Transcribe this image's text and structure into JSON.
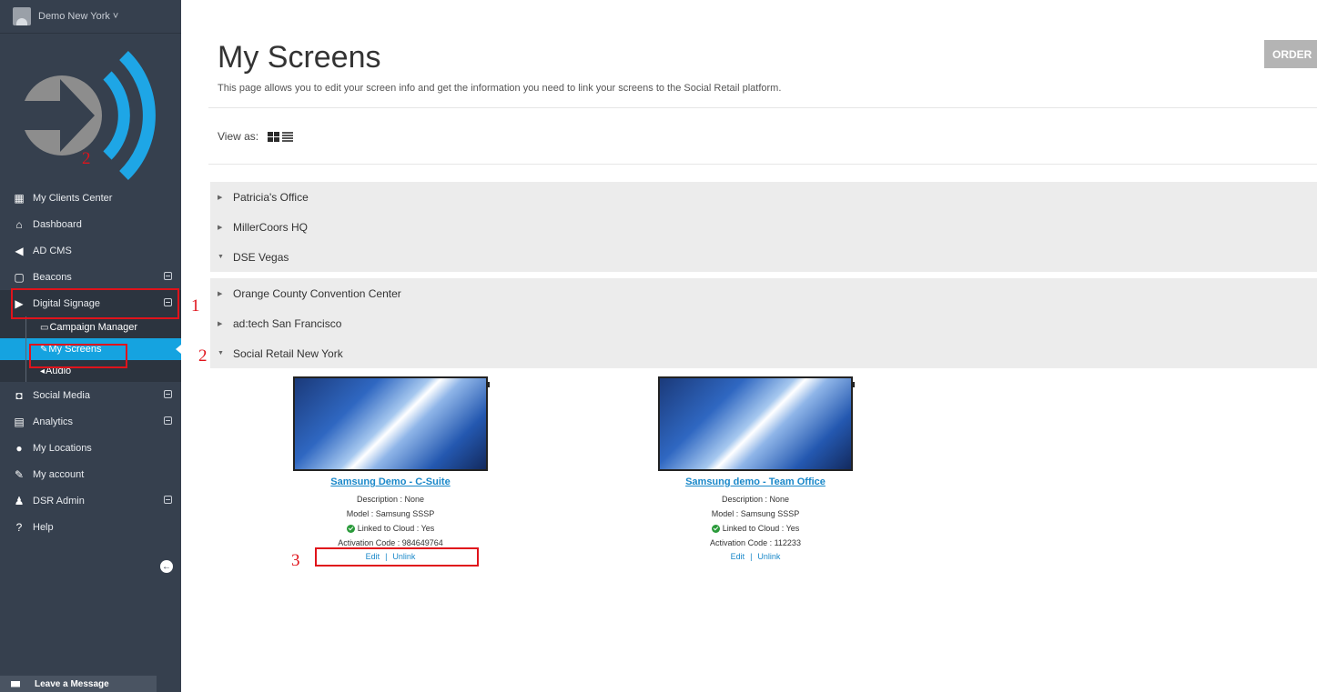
{
  "account": {
    "name": "Demo New York ˅"
  },
  "sidebar": {
    "items": [
      {
        "label": "My Clients Center",
        "icon": "clients-icon"
      },
      {
        "label": "Dashboard",
        "icon": "home-icon"
      },
      {
        "label": "AD CMS",
        "icon": "megaphone-icon"
      },
      {
        "label": "Beacons",
        "icon": "beacon-icon"
      },
      {
        "label": "Digital Signage",
        "icon": "play-icon"
      }
    ],
    "digital_signage_sub": [
      {
        "label": "Campaign Manager",
        "icon": "monitor-icon"
      },
      {
        "label": "My Screens",
        "icon": "edit-icon"
      },
      {
        "label": "Audio",
        "icon": "volume-icon"
      }
    ],
    "items_after": [
      {
        "label": "Social Media",
        "icon": "share-icon"
      },
      {
        "label": "Analytics",
        "icon": "bar-chart-icon"
      },
      {
        "label": "My Locations",
        "icon": "globe-icon"
      },
      {
        "label": "My account",
        "icon": "pencil-square-icon"
      },
      {
        "label": "DSR Admin",
        "icon": "user-icon"
      },
      {
        "label": "Help",
        "icon": "question-icon"
      }
    ],
    "leave_message": "Leave a Message"
  },
  "annotations": {
    "n1": "1",
    "n2": "2",
    "n2b": "2",
    "n3": "3"
  },
  "page": {
    "title": "My Screens",
    "description": "This page allows you to edit your screen info and get the information you need to link your screens to the Social Retail platform.",
    "order_button": "ORDER",
    "view_as_label": "View as:"
  },
  "location_groups": [
    {
      "items": [
        "Patricia's Office",
        "MillerCoors HQ",
        "DSE Vegas"
      ]
    },
    {
      "items": [
        "Orange County Convention Center",
        "ad:tech San Francisco",
        "Social Retail New York"
      ]
    }
  ],
  "screens": [
    {
      "name": "Samsung Demo - C-Suite",
      "description": "Description : None",
      "model": "Model : Samsung SSSP",
      "linked": "Linked to Cloud : Yes",
      "activation": "Activation Code : 984649764",
      "edit": "Edit",
      "unlink": "Unlink"
    },
    {
      "name": "Samsung demo - Team Office",
      "description": "Description : None",
      "model": "Model : Samsung SSSP",
      "linked": "Linked to Cloud : Yes",
      "activation": "Activation Code : 112233",
      "edit": "Edit",
      "unlink": "Unlink"
    }
  ],
  "colors": {
    "sidebar": "#36404e",
    "accent": "#15a3e0",
    "annotation": "#e0131b",
    "link": "#1a88c9"
  }
}
